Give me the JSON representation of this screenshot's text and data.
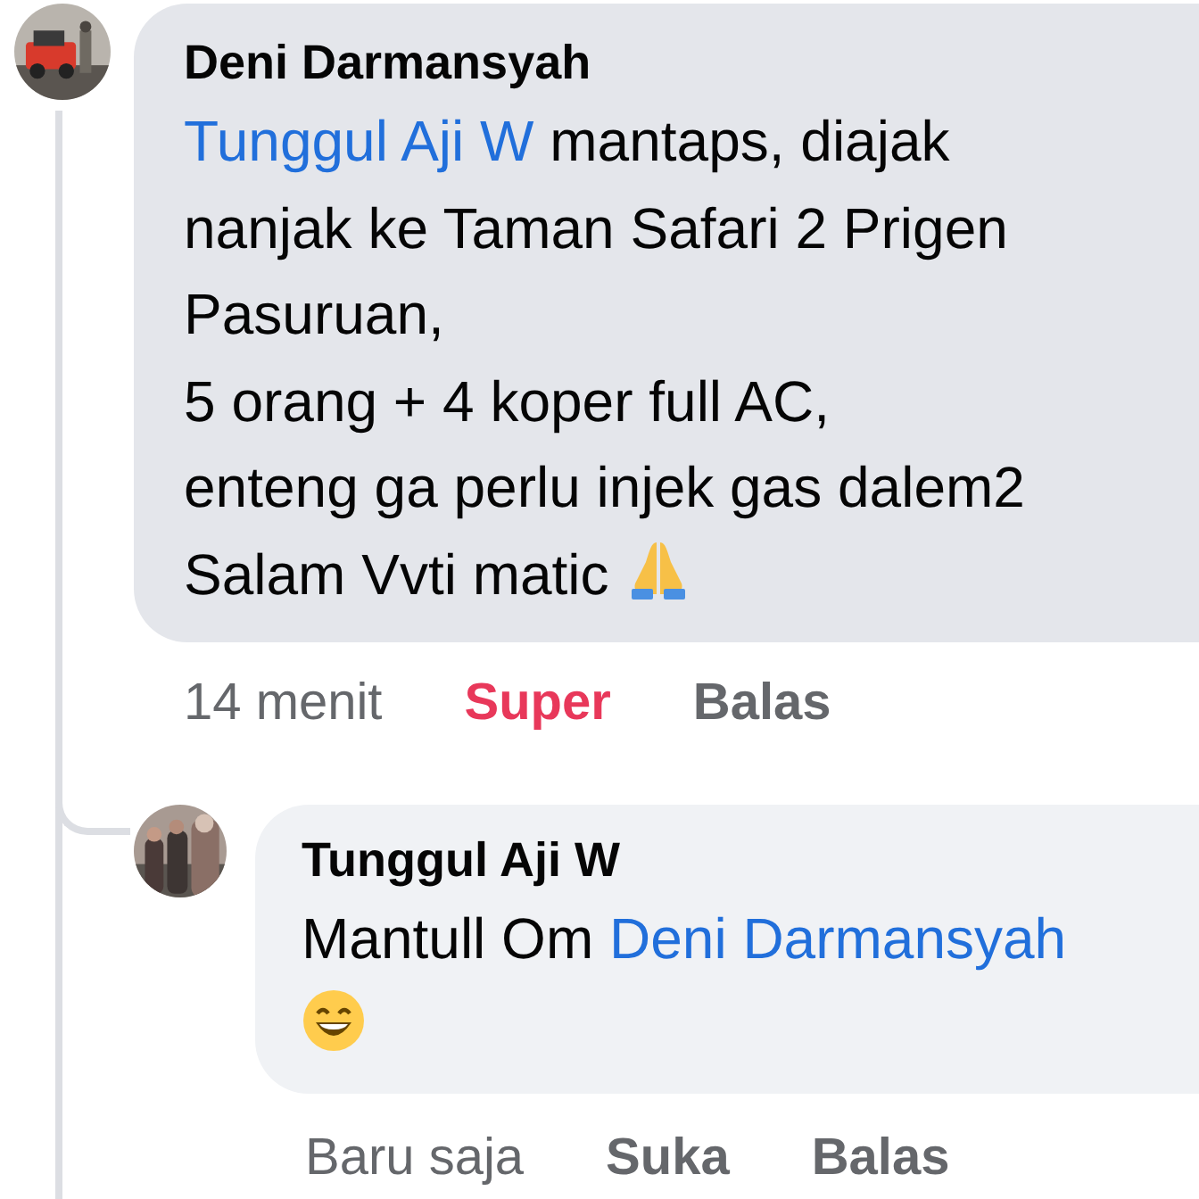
{
  "comments": [
    {
      "author": "Deni Darmansyah",
      "mention": "Tunggul Aji W",
      "lines": [
        "mantaps, diajak",
        "nanjak ke Taman Safari 2 Prigen",
        "Pasuruan,",
        "5 orang + 4 koper full AC,",
        "enteng ga perlu injek gas dalem2",
        "Salam Vvti matic"
      ],
      "time": "14 menit",
      "like": {
        "label": "Super",
        "reacted": true
      },
      "reply": "Balas",
      "replies": [
        {
          "author": "Tunggul Aji W",
          "lines": [
            "Mantull Om"
          ],
          "mention": "Deni Darmansyah",
          "time": "Baru saja",
          "like": {
            "label": "Suka",
            "reacted": false
          },
          "reply": "Balas"
        }
      ]
    }
  ]
}
